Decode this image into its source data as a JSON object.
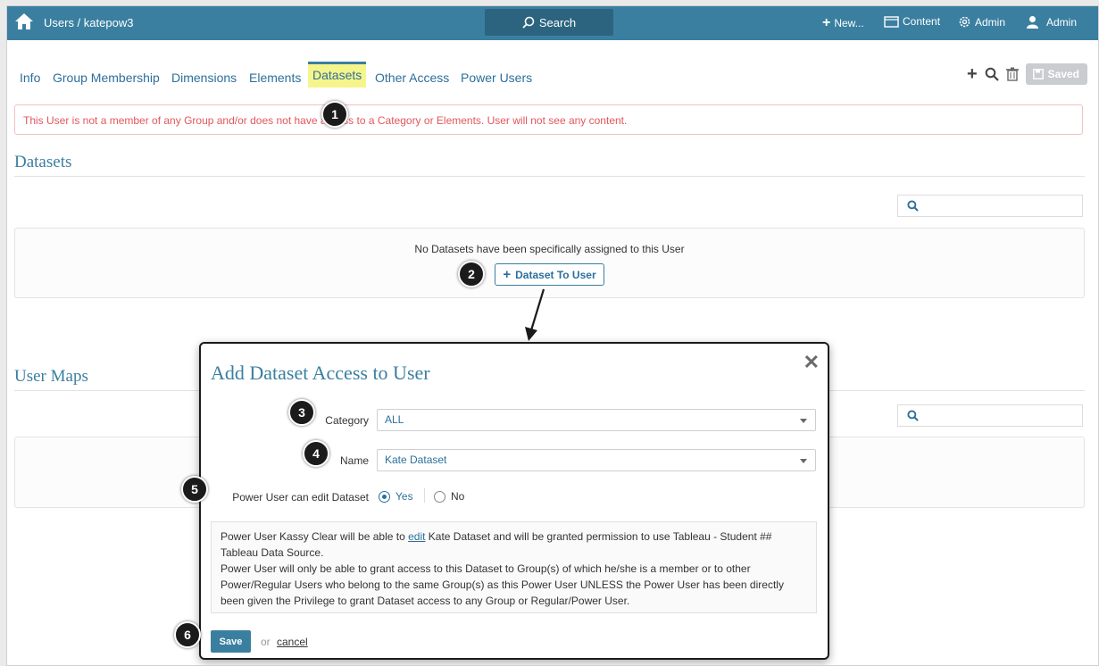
{
  "topbar": {
    "breadcrumb": "Users / katepow3",
    "search_label": "Search",
    "new_label": "New...",
    "content_label": "Content",
    "admin_label": "Admin",
    "user_label": "Admin"
  },
  "tabs": [
    {
      "label": "Info"
    },
    {
      "label": "Group Membership"
    },
    {
      "label": "Dimensions"
    },
    {
      "label": "Elements"
    },
    {
      "label": "Datasets"
    },
    {
      "label": "Other Access"
    },
    {
      "label": "Power Users"
    }
  ],
  "tools": {
    "saved_label": "Saved"
  },
  "alert": "This User is not a member of any Group and/or does not have access to a Category or Elements. User will not see any content.",
  "datasets": {
    "heading": "Datasets",
    "empty_message": "No Datasets have been specifically assigned to this User",
    "add_button": "Dataset To User"
  },
  "user_maps": {
    "heading": "User Maps"
  },
  "modal": {
    "title": "Add Dataset Access to User",
    "category_label": "Category",
    "category_value": "ALL",
    "name_label": "Name",
    "name_value": "Kate Dataset",
    "power_label": "Power User can edit Dataset",
    "yes_label": "Yes",
    "no_label": "No",
    "info_part1": "Power User Kassy Clear will be able to ",
    "info_link": "edit",
    "info_part2": " Kate Dataset and will be granted permission to use Tableau - Student ## Tableau Data Source.",
    "info_part3": "Power User will only be able to grant access to this Dataset to Group(s) of which he/she is a member or to other Power/Regular Users who belong to the same Group(s) as this Power User UNLESS the Power User has been directly been given the Privilege to grant Dataset access to any Group or Regular/Power User.",
    "save_label": "Save",
    "or_label": "or",
    "cancel_label": "cancel"
  },
  "badges": [
    "1",
    "2",
    "3",
    "4",
    "5",
    "6"
  ],
  "colors": {
    "brand": "#3a7fa0",
    "alert": "#e2575b",
    "highlight": "#f6f58c"
  }
}
